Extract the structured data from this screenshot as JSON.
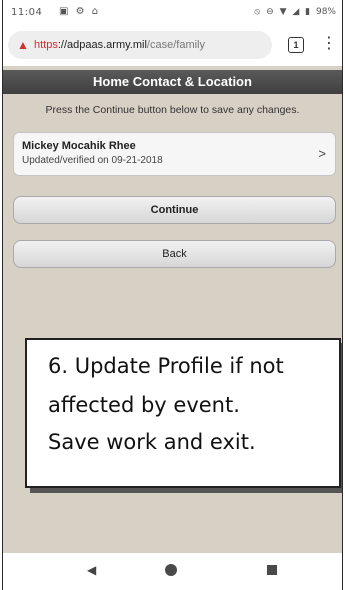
{
  "status_bar": {
    "time": "11:04",
    "battery": "98%",
    "icons": [
      "image-icon",
      "android-icon",
      "alarm-icon",
      "mute-icon",
      "dnd-icon",
      "wifi-icon",
      "signal-icon",
      "battery-icon"
    ]
  },
  "browser": {
    "url_scheme": "https",
    "url_host": "://adpaas.army.mil",
    "url_path": "/case/family",
    "tab_count": "1",
    "security_color": "#d32f2f"
  },
  "page": {
    "title": "Home Contact & Location",
    "instructions": "Press the Continue button below to save any changes.",
    "contact": {
      "name": "Mickey Mocahik Rhee",
      "updated": "Updated/verified on 09-21-2018"
    },
    "continue_label": "Continue",
    "back_label": "Back"
  },
  "callout": {
    "line1": "6. Update Profile if not",
    "line2": "affected by event.",
    "line3": "Save work and exit."
  },
  "nav_bar": {
    "icons": [
      "back-icon",
      "home-icon",
      "recents-icon"
    ]
  }
}
